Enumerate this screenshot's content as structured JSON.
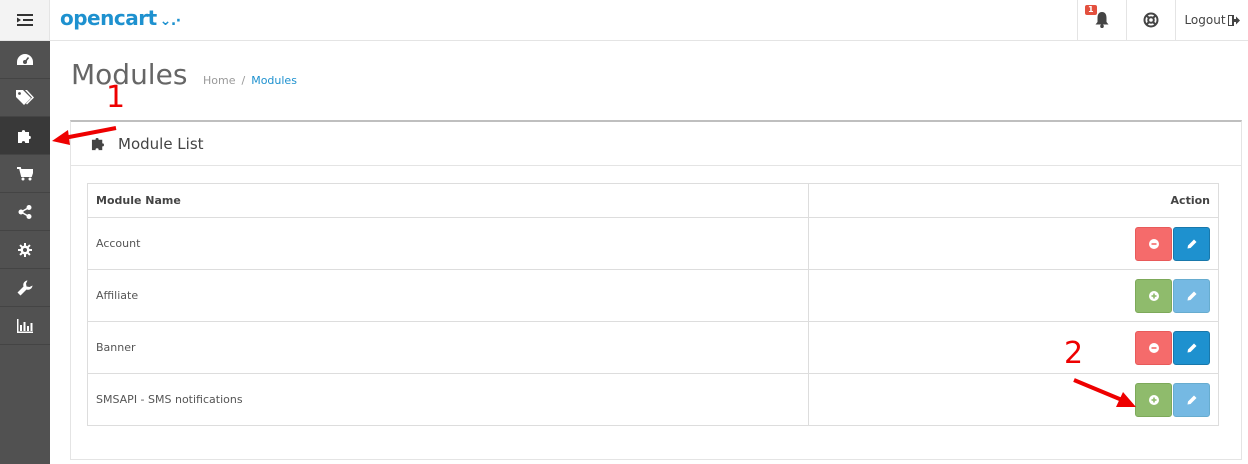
{
  "header": {
    "logo": "opencart",
    "notification_count": "1",
    "logout_label": "Logout"
  },
  "page": {
    "title": "Modules",
    "breadcrumb": [
      "Home",
      "Modules"
    ]
  },
  "panel": {
    "title": "Module List"
  },
  "table": {
    "columns": [
      "Module Name",
      "Action"
    ],
    "rows": [
      {
        "name": "Account",
        "installed": true
      },
      {
        "name": "Affiliate",
        "installed": false
      },
      {
        "name": "Banner",
        "installed": true
      },
      {
        "name": "SMSAPI - SMS notifications",
        "installed": false
      }
    ]
  },
  "annotations": [
    "1",
    "2"
  ],
  "colors": {
    "accent": "#1e91cf",
    "danger": "#f56b6b",
    "success": "#8fbb6c",
    "sidebar": "#515151",
    "annotation": "#ee0000"
  }
}
